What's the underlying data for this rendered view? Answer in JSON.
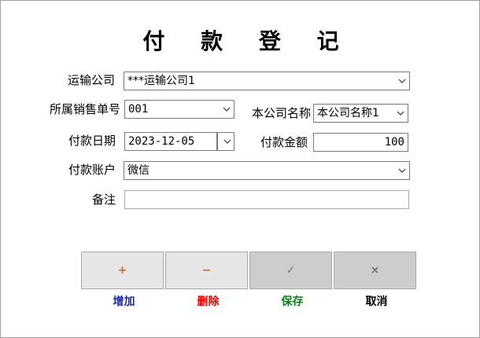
{
  "title": "付 款 登 记",
  "form": {
    "company": {
      "label": "运输公司",
      "value": "***运输公司1"
    },
    "order": {
      "label": "所属销售单号",
      "value": "001"
    },
    "our_company": {
      "label": "本公司名称",
      "value": "本公司名称1"
    },
    "date": {
      "label": "付款日期",
      "value": "2023-12-05"
    },
    "amount": {
      "label": "付款金额",
      "value": "100"
    },
    "account": {
      "label": "付款账户",
      "value": "微信"
    },
    "remark": {
      "label": "备注",
      "value": ""
    }
  },
  "buttons": {
    "add": {
      "symbol": "+",
      "label": "增加",
      "symbol_color": "#e2611a",
      "label_color": "#1a2ca8"
    },
    "delete": {
      "symbol": "−",
      "label": "删除",
      "symbol_color": "#e2611a",
      "label_color": "#e00000"
    },
    "save": {
      "symbol": "✓",
      "label": "保存",
      "symbol_color": "#777777",
      "label_color": "#0a7a1a"
    },
    "cancel": {
      "symbol": "×",
      "label": "取消",
      "symbol_color": "#777777",
      "label_color": "#000000"
    }
  }
}
